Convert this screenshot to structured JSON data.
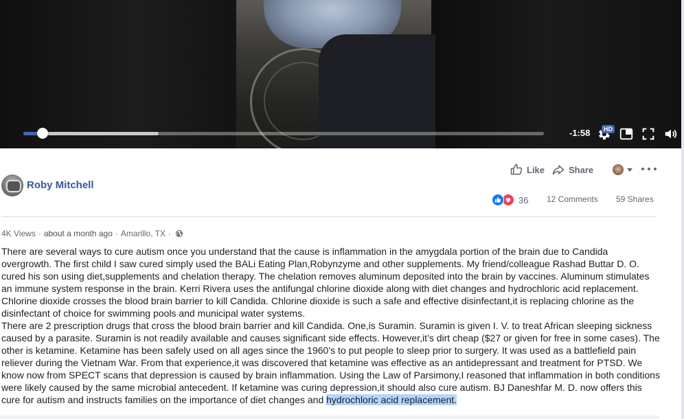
{
  "video": {
    "time_remaining": "-1:58",
    "progress_played": 0.037,
    "progress_buffered": 0.26,
    "quality_badge": "HD"
  },
  "post": {
    "author": "Roby Mitchell",
    "actions": {
      "like": "Like",
      "share": "Share"
    },
    "reactions": {
      "count": "36",
      "comments": "12 Comments",
      "shares": "59 Shares"
    },
    "meta": {
      "views": "4K Views",
      "time": "about a month ago",
      "location": "Amarillo, TX"
    },
    "paragraph1": "There are several ways to cure autism once you understand that the cause is inflammation in the amygdala portion of the brain due to Candida overgrowth. The first child I saw cured simply used the BALi Eating Plan,Robynzyme and other supplements. My friend/colleague Rashad Buttar D. O. cured his son using diet,supplements and chelation therapy. The chelation removes aluminum deposited into the brain by vaccines. Aluminum stimulates an immune system response in the brain. Kerri Rivera uses the antifungal chlorine dioxide along with diet changes and hydrochloric acid replacement. Chlorine dioxide crosses the blood brain barrier to kill Candida. Chlorine dioxide is such a safe and effective disinfectant,it is replacing chlorine as the disinfectant of choice for swimming pools and municipal water systems.",
    "paragraph2_main": "There are 2 prescription drugs that cross the blood brain barrier and kill Candida. One,is Suramin. Suramin is given I. V. to treat African sleeping sickness caused by a parasite. Suramin is not readily available and causes significant side effects. However,it’s dirt cheap ($27 or given for free in some cases). The other is ketamine. Ketamine has been safely used on all ages since the 1960’s to put people to sleep prior to surgery. It was used as a battlefield pain reliever during the Vietnam War. From that experience,it was discovered that ketamine was effective as an antidepressant and treatment for PTSD. We know now from SPECT scans that depression is caused by brain inflammation. Using the Law of Parsimony,I reasoned that inflammation in both conditions were likely caused by the same microbial antecedent. If ketamine was curing depression,it should also cure autism. BJ Daneshfar M. D. now offers this cure for autism and instructs families on the importance of diet changes and ",
    "paragraph2_highlight": "hydrochloric acid replacement."
  },
  "colors": {
    "accent": "#4267b2",
    "author_link": "#385898",
    "like_blue": "#1877f2",
    "love_red": "#f33e58",
    "highlight": "#b4d5fe"
  },
  "icons": [
    "settings-gear-icon",
    "picture-in-picture-icon",
    "fullscreen-icon",
    "volume-icon",
    "thumbs-up-icon",
    "share-arrow-icon",
    "chevron-down-icon",
    "more-dots-icon",
    "globe-icon"
  ]
}
